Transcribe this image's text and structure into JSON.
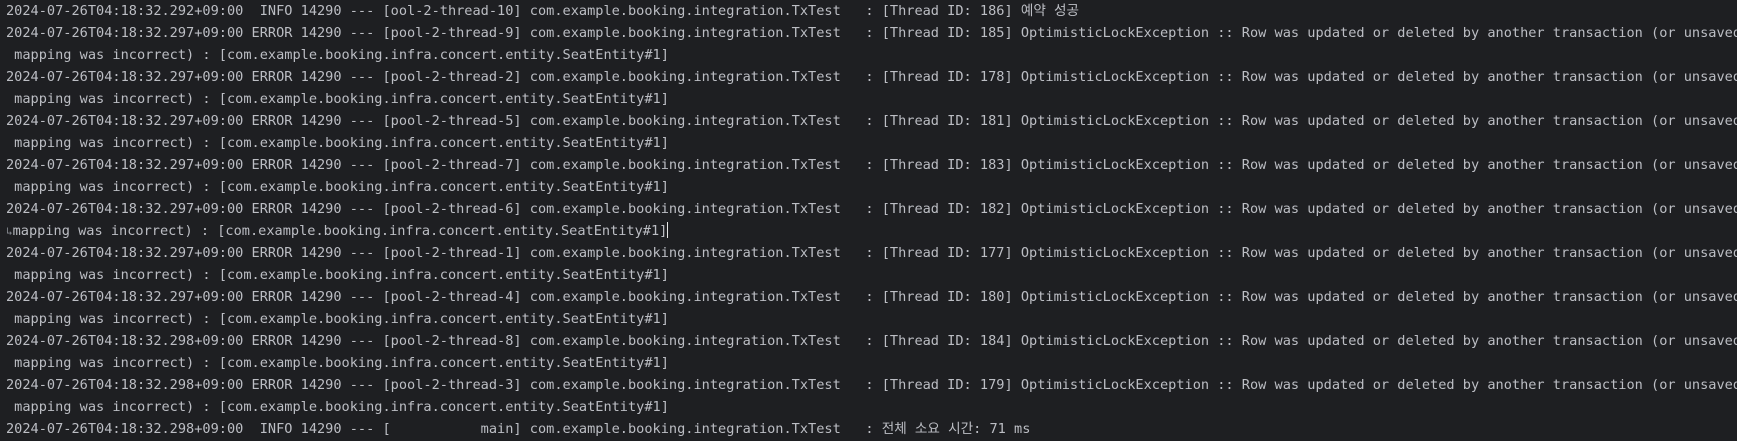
{
  "console": {
    "lines": [
      {
        "text": "2024-07-26T04:18:32.292+09:00  INFO 14290 --- [ool-2-thread-10] com.example.booking.integration.TxTest   : [Thread ID: 186] 예약 성공"
      },
      {
        "text": "2024-07-26T04:18:32.297+09:00 ERROR 14290 --- [pool-2-thread-9] com.example.booking.integration.TxTest   : [Thread ID: 185] OptimisticLockException :: Row was updated or deleted by another transaction (or unsaved-value"
      },
      {
        "text": " mapping was incorrect) : [com.example.booking.infra.concert.entity.SeatEntity#1]"
      },
      {
        "text": "2024-07-26T04:18:32.297+09:00 ERROR 14290 --- [pool-2-thread-2] com.example.booking.integration.TxTest   : [Thread ID: 178] OptimisticLockException :: Row was updated or deleted by another transaction (or unsaved-value"
      },
      {
        "text": " mapping was incorrect) : [com.example.booking.infra.concert.entity.SeatEntity#1]"
      },
      {
        "text": "2024-07-26T04:18:32.297+09:00 ERROR 14290 --- [pool-2-thread-5] com.example.booking.integration.TxTest   : [Thread ID: 181] OptimisticLockException :: Row was updated or deleted by another transaction (or unsaved-value"
      },
      {
        "text": " mapping was incorrect) : [com.example.booking.infra.concert.entity.SeatEntity#1]"
      },
      {
        "text": "2024-07-26T04:18:32.297+09:00 ERROR 14290 --- [pool-2-thread-7] com.example.booking.integration.TxTest   : [Thread ID: 183] OptimisticLockException :: Row was updated or deleted by another transaction (or unsaved-value"
      },
      {
        "text": " mapping was incorrect) : [com.example.booking.infra.concert.entity.SeatEntity#1]"
      },
      {
        "text": "2024-07-26T04:18:32.297+09:00 ERROR 14290 --- [pool-2-thread-6] com.example.booking.integration.TxTest   : [Thread ID: 182] OptimisticLockException :: Row was updated or deleted by another transaction (or unsaved-value "
      },
      {
        "text": "mapping was incorrect) : [com.example.booking.infra.concert.entity.SeatEntity#1]"
      },
      {
        "text": "2024-07-26T04:18:32.297+09:00 ERROR 14290 --- [pool-2-thread-1] com.example.booking.integration.TxTest   : [Thread ID: 177] OptimisticLockException :: Row was updated or deleted by another transaction (or unsaved-value"
      },
      {
        "text": " mapping was incorrect) : [com.example.booking.infra.concert.entity.SeatEntity#1]"
      },
      {
        "text": "2024-07-26T04:18:32.297+09:00 ERROR 14290 --- [pool-2-thread-4] com.example.booking.integration.TxTest   : [Thread ID: 180] OptimisticLockException :: Row was updated or deleted by another transaction (or unsaved-value"
      },
      {
        "text": " mapping was incorrect) : [com.example.booking.infra.concert.entity.SeatEntity#1]"
      },
      {
        "text": "2024-07-26T04:18:32.298+09:00 ERROR 14290 --- [pool-2-thread-8] com.example.booking.integration.TxTest   : [Thread ID: 184] OptimisticLockException :: Row was updated or deleted by another transaction (or unsaved-value"
      },
      {
        "text": " mapping was incorrect) : [com.example.booking.infra.concert.entity.SeatEntity#1]"
      },
      {
        "text": "2024-07-26T04:18:32.298+09:00 ERROR 14290 --- [pool-2-thread-3] com.example.booking.integration.TxTest   : [Thread ID: 179] OptimisticLockException :: Row was updated or deleted by another transaction (or unsaved-value"
      },
      {
        "text": " mapping was incorrect) : [com.example.booking.infra.concert.entity.SeatEntity#1]"
      },
      {
        "text": "2024-07-26T04:18:32.298+09:00  INFO 14290 --- [           main] com.example.booking.integration.TxTest   : 전체 소요 시간: 71 ms"
      }
    ],
    "colors": {
      "background": "#1e1f22",
      "text": "#bcbec4"
    }
  }
}
